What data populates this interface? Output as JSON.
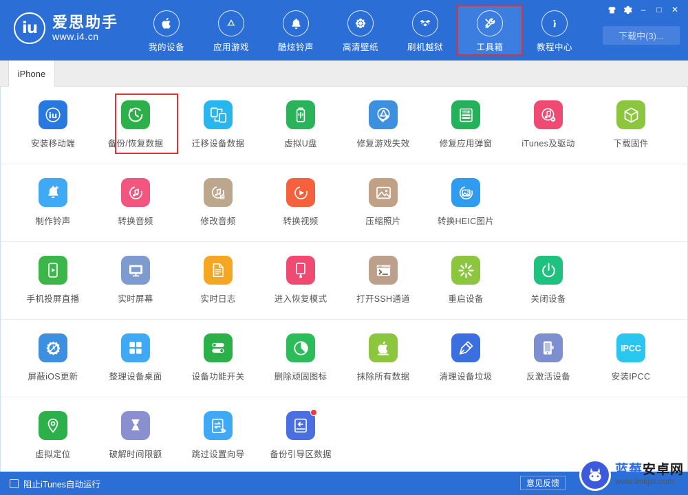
{
  "header": {
    "logo_mark": "iu",
    "logo_name": "爱思助手",
    "logo_url": "www.i4.cn",
    "nav": [
      {
        "label": "我的设备",
        "icon": "apple-icon"
      },
      {
        "label": "应用游戏",
        "icon": "appstore-icon"
      },
      {
        "label": "酷炫铃声",
        "icon": "bell-icon"
      },
      {
        "label": "高清壁纸",
        "icon": "flower-icon"
      },
      {
        "label": "刷机越狱",
        "icon": "box-icon"
      },
      {
        "label": "工具箱",
        "icon": "tools-icon"
      },
      {
        "label": "教程中心",
        "icon": "info-icon"
      }
    ],
    "active_nav_index": 5,
    "highlight_nav_index": 5,
    "window_buttons": [
      {
        "name": "skin-icon",
        "glyph": "♟"
      },
      {
        "name": "settings-icon",
        "glyph": "⚙"
      },
      {
        "name": "minimize-icon",
        "glyph": "–"
      },
      {
        "name": "maximize-icon",
        "glyph": "□"
      },
      {
        "name": "close-icon",
        "glyph": "✕"
      }
    ],
    "download_button": "下载中(3)..."
  },
  "tabs": [
    {
      "label": "iPhone",
      "active": true
    }
  ],
  "toolbox": {
    "rows": [
      [
        {
          "label": "安装移动端",
          "icon": "i4-app-icon",
          "bg": "#2878e0",
          "selected": false
        },
        {
          "label": "备份/恢复数据",
          "icon": "backup-restore-icon",
          "bg": "#2cb14a",
          "selected": true
        },
        {
          "label": "迁移设备数据",
          "icon": "migrate-device-icon",
          "bg": "#29b6ef",
          "selected": false
        },
        {
          "label": "虚拟U盘",
          "icon": "usb-drive-icon",
          "bg": "#2bb35c",
          "selected": false
        },
        {
          "label": "修复游戏失效",
          "icon": "fix-game-icon",
          "bg": "#3d8fe0",
          "selected": false
        },
        {
          "label": "修复应用弹窗",
          "icon": "appleid-popup-icon",
          "bg": "#23b15b",
          "selected": false
        },
        {
          "label": "iTunes及驱动",
          "icon": "itunes-driver-icon",
          "bg": "#ef4a72",
          "selected": false
        },
        {
          "label": "下载固件",
          "icon": "firmware-box-icon",
          "bg": "#8cc63e",
          "selected": false
        }
      ],
      [
        {
          "label": "制作铃声",
          "icon": "make-ringtone-icon",
          "bg": "#3fa9f5",
          "selected": false
        },
        {
          "label": "转换音频",
          "icon": "convert-audio-icon",
          "bg": "#f2567f",
          "selected": false
        },
        {
          "label": "修改音频",
          "icon": "edit-audio-icon",
          "bg": "#bda78c",
          "selected": false
        },
        {
          "label": "转换视频",
          "icon": "convert-video-icon",
          "bg": "#f4613c",
          "selected": false
        },
        {
          "label": "压缩照片",
          "icon": "compress-photo-icon",
          "bg": "#c0a185",
          "selected": false
        },
        {
          "label": "转换HEIC图片",
          "icon": "heic-convert-icon",
          "bg": "#2f9cf0",
          "selected": false
        }
      ],
      [
        {
          "label": "手机投屏直播",
          "icon": "screen-cast-icon",
          "bg": "#3cb54a",
          "selected": false
        },
        {
          "label": "实时屏幕",
          "icon": "realtime-screen-icon",
          "bg": "#7e9bd0",
          "selected": false
        },
        {
          "label": "实时日志",
          "icon": "realtime-log-icon",
          "bg": "#f5a623",
          "selected": false
        },
        {
          "label": "进入恢复模式",
          "icon": "recovery-mode-icon",
          "bg": "#ef4a72",
          "selected": false
        },
        {
          "label": "打开SSH通道",
          "icon": "ssh-tunnel-icon",
          "bg": "#bda08c",
          "selected": false
        },
        {
          "label": "重启设备",
          "icon": "reboot-device-icon",
          "bg": "#8cc63e",
          "selected": false
        },
        {
          "label": "关闭设备",
          "icon": "power-off-icon",
          "bg": "#1fc17e",
          "selected": false
        }
      ],
      [
        {
          "label": "屏蔽iOS更新",
          "icon": "block-ios-update-icon",
          "bg": "#3d8fe0",
          "selected": false
        },
        {
          "label": "整理设备桌面",
          "icon": "arrange-desktop-icon",
          "bg": "#3fa9f5",
          "selected": false
        },
        {
          "label": "设备功能开关",
          "icon": "feature-toggle-icon",
          "bg": "#2cb14a",
          "selected": false
        },
        {
          "label": "删除顽固图标",
          "icon": "delete-icon-icon",
          "bg": "#2cbd5a",
          "selected": false
        },
        {
          "label": "抹除所有数据",
          "icon": "erase-all-icon",
          "bg": "#8cc63e",
          "selected": false
        },
        {
          "label": "清理设备垃圾",
          "icon": "clean-junk-icon",
          "bg": "#3b6fe0",
          "selected": false
        },
        {
          "label": "反激活设备",
          "icon": "deactivate-device-icon",
          "bg": "#7e8fd0",
          "selected": false
        },
        {
          "label": "安装IPCC",
          "icon": "ipcc-icon",
          "bg": "#29c6ef",
          "selected": false,
          "text": "IPCC"
        }
      ],
      [
        {
          "label": "虚拟定位",
          "icon": "virtual-location-icon",
          "bg": "#2cb14a",
          "selected": false
        },
        {
          "label": "破解时间限额",
          "icon": "crack-time-limit-icon",
          "bg": "#8a8fd0",
          "selected": false
        },
        {
          "label": "跳过设置向导",
          "icon": "skip-setup-icon",
          "bg": "#3fa9f5",
          "selected": false
        },
        {
          "label": "备份引导区数据",
          "icon": "backup-boot-icon",
          "bg": "#4a6fe0",
          "selected": false,
          "badge": true
        }
      ]
    ]
  },
  "bottom": {
    "checkbox_label": "阻止iTunes自动运行",
    "checkbox_checked": false,
    "feedback_button": "意见反馈"
  },
  "watermark": {
    "cn_blue": "蓝莓",
    "cn_black": "安卓网",
    "url": "www.lmkjst.com"
  },
  "colors": {
    "brand_blue": "#2b6fd6",
    "highlight_red": "#e03030",
    "nav_active": "#3b7ee0"
  }
}
